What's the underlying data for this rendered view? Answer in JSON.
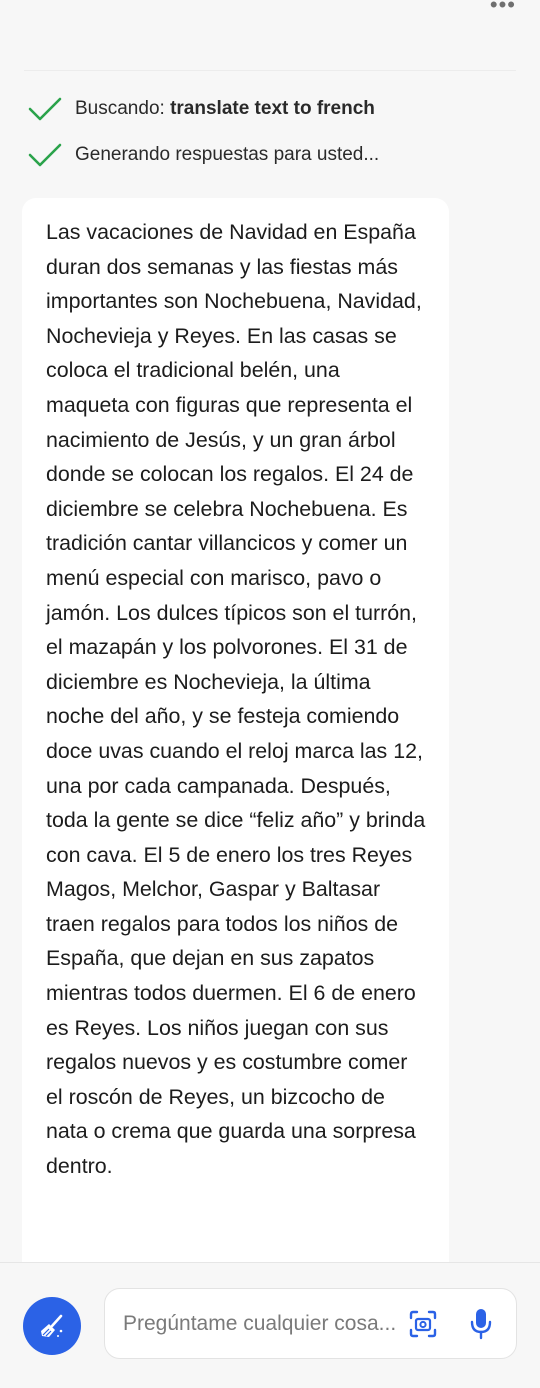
{
  "header": {
    "more_menu_glyph": "•••"
  },
  "status": {
    "searching_prefix": "Buscando: ",
    "searching_query": "translate text to french",
    "generating": "Generando respuestas para usted..."
  },
  "response": {
    "text": "Las vacaciones de Navidad en España duran dos semanas y las fiestas más importantes son Nochebuena, Navidad, Nochevieja y Reyes. En las casas se coloca el tradicional belén, una maqueta con figuras que representa el nacimiento de Jesús, y un gran árbol donde se colocan los regalos. El 24 de diciembre se celebra Nochebuena. Es tradición cantar villancicos y comer un menú especial con marisco, pavo o jamón. Los dulces típicos son el turrón, el mazapán y los polvorones. El 31 de diciembre es Nochevieja, la última noche del año, y se festeja comiendo doce uvas cuando el reloj marca las 12, una por cada campanada. Después, toda la gente se dice “feliz año” y brinda con cava. El 5 de enero los tres Reyes Magos, Melchor, Gaspar y Baltasar traen regalos para todos los niños de España, que dejan en sus zapatos mientras todos duermen. El 6 de enero es Reyes. Los niños juegan con sus regalos nuevos y es costumbre comer el roscón de Reyes, un bizcocho de nata o crema que guarda una sorpresa dentro."
  },
  "input": {
    "placeholder": "Pregúntame cualquier cosa..."
  },
  "icons": {
    "check": "check-icon",
    "broom": "broom-icon",
    "camera": "camera-scan-icon",
    "mic": "microphone-icon"
  },
  "colors": {
    "check_green": "#2aa34a",
    "accent_blue": "#2b62e6"
  }
}
